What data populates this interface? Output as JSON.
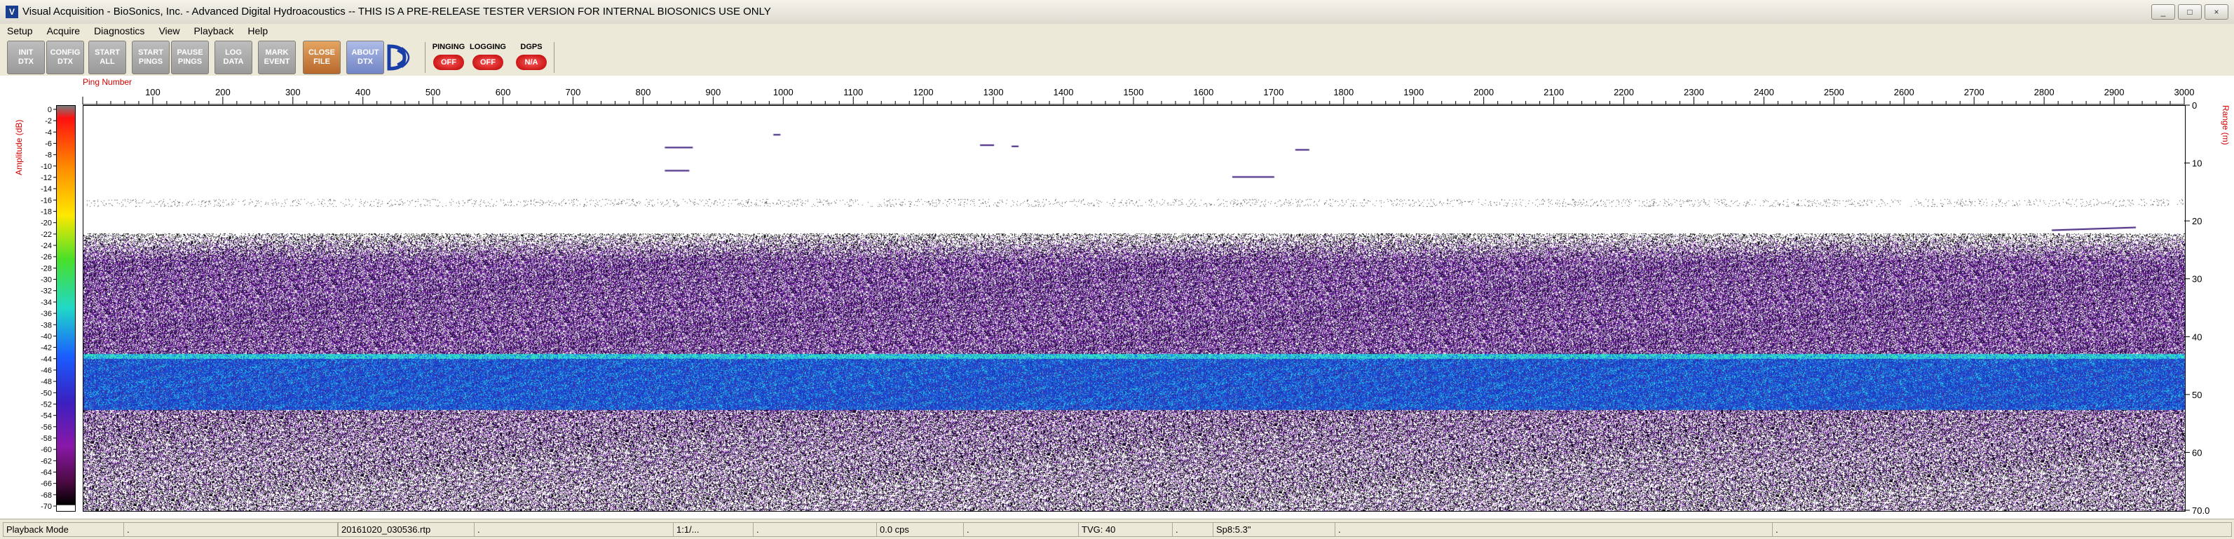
{
  "window": {
    "title": "Visual Acquisition  -  BioSonics, Inc.  -  Advanced Digital Hydroacoustics  -- THIS IS A PRE-RELEASE TESTER VERSION FOR INTERNAL BIOSONICS USE ONLY",
    "controls": [
      "_",
      "□",
      "×"
    ]
  },
  "menu": [
    "Setup",
    "Acquire",
    "Diagnostics",
    "View",
    "Playback",
    "Help"
  ],
  "toolbar": {
    "buttons": [
      {
        "line1": "INIT",
        "line2": "DTX"
      },
      {
        "line1": "CONFIG",
        "line2": "DTX"
      },
      {
        "line1": "START",
        "line2": "ALL"
      },
      {
        "line1": "START",
        "line2": "PINGS"
      },
      {
        "line1": "PAUSE",
        "line2": "PINGS"
      },
      {
        "line1": "LOG",
        "line2": "DATA"
      },
      {
        "line1": "MARK",
        "line2": "EVENT"
      },
      {
        "line1": "CLOSE",
        "line2": "FILE"
      },
      {
        "line1": "ABOUT",
        "line2": "DTX"
      }
    ],
    "status": [
      {
        "label": "PINGING",
        "value": "OFF"
      },
      {
        "label": "LOGGING",
        "value": "OFF"
      },
      {
        "label": "DGPS",
        "value": "N/A"
      }
    ]
  },
  "echogram": {
    "x_title": "Ping Number",
    "left_axis_label": "Amplitude (dB)",
    "right_axis_label": "Range (m)",
    "x_ticks": [
      "100",
      "200",
      "300",
      "400",
      "500",
      "600",
      "700",
      "800",
      "900",
      "1000",
      "1100",
      "1200",
      "1300",
      "1400",
      "1500",
      "1600",
      "1700",
      "1800",
      "1900",
      "2000",
      "2100",
      "2200",
      "2300",
      "2400",
      "2500",
      "2600",
      "2700",
      "2800",
      "2900",
      "3000"
    ],
    "colorbar_ticks": [
      "0",
      "-2",
      "-4",
      "-6",
      "-8",
      "-10",
      "-12",
      "-14",
      "-16",
      "-18",
      "-20",
      "-22",
      "-24",
      "-26",
      "-28",
      "-30",
      "-32",
      "-34",
      "-36",
      "-38",
      "-40",
      "-42",
      "-44",
      "-46",
      "-48",
      "-50",
      "-52",
      "-54",
      "-56",
      "-58",
      "-60",
      "-62",
      "-64",
      "-66",
      "-68",
      "-70"
    ],
    "range_ticks": [
      "0",
      "10",
      "20",
      "30",
      "40",
      "50",
      "60",
      "70.0"
    ],
    "x_range": [
      0,
      3000
    ],
    "range_m": [
      0,
      70
    ],
    "amplitude_db": [
      0,
      -70
    ],
    "colors": {
      "bottom_band": "#1d4fd8",
      "bottom_edge": "#36e6b8",
      "noise": "#5b1a8a",
      "axis_label": "#d40000"
    }
  },
  "statusbar": [
    "Playback Mode",
    ".",
    "20161020_030536.rtp",
    ".",
    "1:1/...",
    ".",
    "0.0 cps",
    ".",
    "TVG: 40",
    ".",
    "Sp8:5.3\"",
    ".",
    "."
  ]
}
